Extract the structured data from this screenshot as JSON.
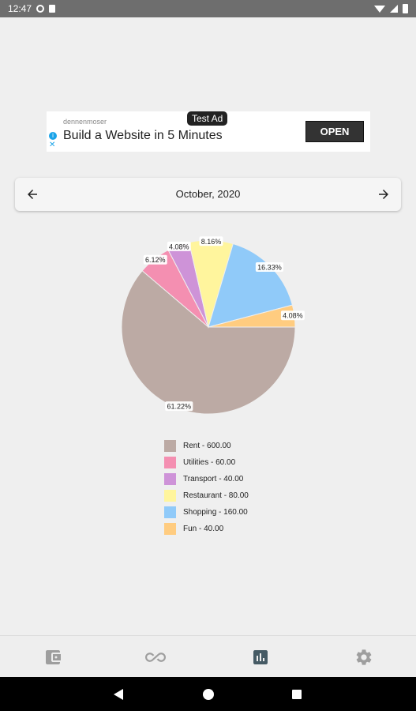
{
  "status_bar": {
    "time": "12:47",
    "icons": [
      "notification-p-icon",
      "sd-card-icon",
      "wifi-icon",
      "signal-icon",
      "battery-icon"
    ]
  },
  "ad": {
    "badge": "Test Ad",
    "advertiser": "dennenmoser",
    "headline": "Build a Website in 5 Minutes",
    "cta": "OPEN"
  },
  "month_selector": {
    "title": "October, 2020",
    "prev_icon": "arrow-left-icon",
    "next_icon": "arrow-right-icon"
  },
  "chart_data": {
    "type": "pie",
    "categories": [
      "Rent",
      "Utilities",
      "Transport",
      "Restaurant",
      "Shopping",
      "Fun"
    ],
    "values": [
      600.0,
      60.0,
      40.0,
      80.0,
      160.0,
      40.0
    ],
    "percent_labels": [
      "61.22%",
      "6.12%",
      "4.08%",
      "8.16%",
      "16.33%",
      "4.08%"
    ],
    "colors": [
      "#bcaaa4",
      "#f48fb1",
      "#ce93d8",
      "#fff59d",
      "#90caf9",
      "#ffcc80"
    ],
    "legend_labels": [
      "Rent - 600.00",
      "Utilities - 60.00",
      "Transport - 40.00",
      "Restaurant - 80.00",
      "Shopping - 160.00",
      "Fun - 40.00"
    ]
  },
  "bottom_nav": {
    "items": [
      "wallet-icon",
      "recurring-icon",
      "stats-icon",
      "settings-icon"
    ],
    "active": "stats-icon",
    "active_color": "#455a64",
    "inactive_color": "#9e9e9e"
  }
}
